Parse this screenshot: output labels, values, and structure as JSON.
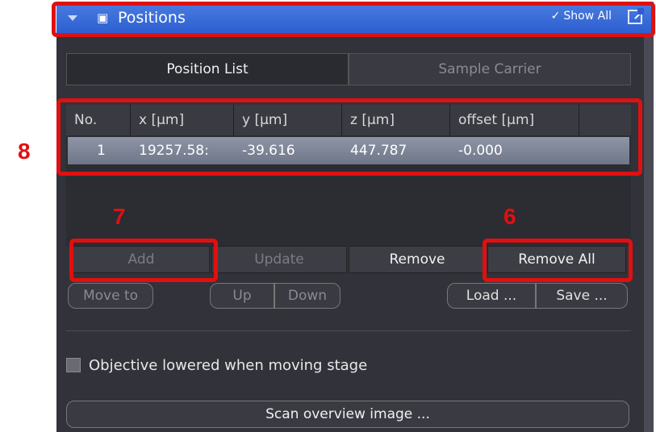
{
  "header": {
    "title": "Positions",
    "show_all": "Show All",
    "icons": {
      "collapse": "triangle-down-icon",
      "positions": "positions-icon",
      "detach": "detach-window-icon"
    }
  },
  "tabs": [
    {
      "label": "Position List",
      "active": true
    },
    {
      "label": "Sample Carrier",
      "active": false
    }
  ],
  "table": {
    "columns": [
      "No.",
      "x [µm]",
      "y [µm]",
      "z [µm]",
      "offset [µm]"
    ],
    "rows": [
      [
        "1",
        "19257.58:",
        "-39.616",
        "447.787",
        "-0.000"
      ]
    ]
  },
  "buttons": {
    "add": "Add",
    "update": "Update",
    "remove": "Remove",
    "remove_all": "Remove All",
    "move_to": "Move to",
    "up": "Up",
    "down": "Down",
    "load": "Load ...",
    "save": "Save ...",
    "scan_overview": "Scan overview image ..."
  },
  "checkbox": {
    "label": "Objective lowered when moving stage",
    "checked": false
  },
  "annotations": [
    "8",
    "7",
    "6"
  ],
  "colors": {
    "header_blue": "#2d5ed0",
    "panel_bg": "#32323a",
    "annotation_red": "#e01010",
    "selected_row": "#7d8496"
  }
}
